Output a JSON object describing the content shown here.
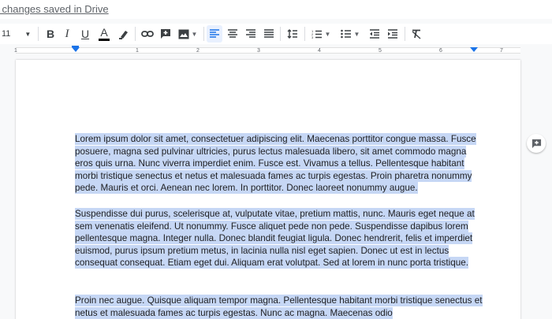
{
  "status": {
    "saved_text": "l changes saved in Drive"
  },
  "toolbar": {
    "font_size": "11",
    "bold_label": "B",
    "italic_label": "I",
    "underline_label": "U",
    "text_color_label": "A",
    "icons": [
      "highlighter-icon",
      "link-icon",
      "add-comment-icon",
      "insert-image-icon",
      "align-left-icon",
      "align-center-icon",
      "align-right-icon",
      "justify-icon",
      "line-spacing-icon",
      "numbered-list-icon",
      "bulleted-list-icon",
      "decrease-indent-icon",
      "increase-indent-icon",
      "clear-formatting-icon"
    ],
    "active_alignment": "left",
    "accent_color": "#1a73e8"
  },
  "ruler": {
    "numbers": [
      "1",
      "1",
      "2",
      "3",
      "4",
      "5",
      "6",
      "7"
    ]
  },
  "document": {
    "selection_color": "#c6d7f5",
    "paragraphs": [
      "Lorem ipsum dolor sit amet, consectetuer adipiscing elit. Maecenas porttitor congue massa. Fusce posuere, magna sed pulvinar ultricies, purus lectus malesuada libero, sit amet commodo magna eros quis urna. Nunc viverra imperdiet enim. Fusce est. Vivamus a tellus. Pellentesque habitant morbi tristique senectus et netus et malesuada fames ac turpis egestas. Proin pharetra nonummy pede. Mauris et orci. Aenean nec lorem. In porttitor. Donec laoreet nonummy augue.",
      "Suspendisse dui purus, scelerisque at, vulputate vitae, pretium mattis, nunc. Mauris eget neque at sem venenatis eleifend. Ut nonummy. Fusce aliquet pede non pede. Suspendisse dapibus lorem pellentesque magna. Integer nulla. Donec blandit feugiat ligula. Donec hendrerit, felis et imperdiet euismod, purus ipsum pretium metus, in lacinia nulla nisl eget sapien. Donec ut est in lectus consequat consequat. Etiam eget dui. Aliquam erat volutpat. Sed at lorem in nunc porta tristique.",
      "Proin nec augue. Quisque aliquam tempor magna. Pellentesque habitant morbi tristique senectus et netus et malesuada fames ac turpis egestas. Nunc ac magna. Maecenas odio"
    ]
  }
}
